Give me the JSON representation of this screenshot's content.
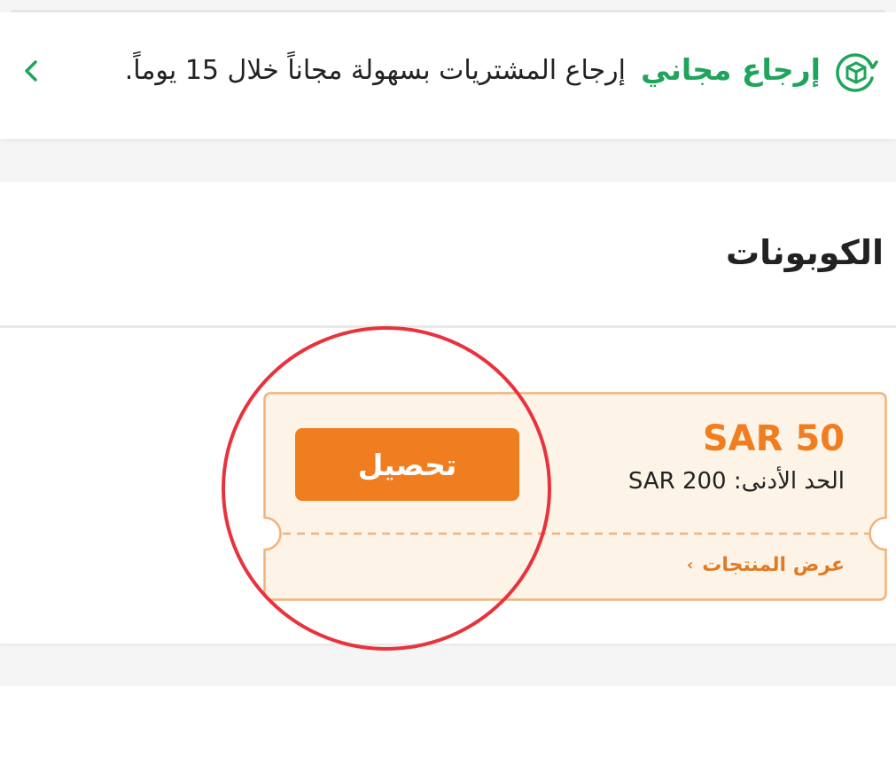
{
  "return_banner": {
    "title": "إرجاع مجاني",
    "description": "إرجاع المشتريات بسهولة مجاناً خلال 15 يوماً.",
    "icon": "return-box-icon",
    "accent": "#1fa55b"
  },
  "coupons": {
    "title": "الكوبونات",
    "coupon": {
      "amount": "SAR 50",
      "minimum": "الحد الأدنى: SAR 200",
      "collect_label": "تحصيل",
      "view_products": "عرض المنتجات",
      "accent": "#f07d1f",
      "background": "#fef3e7"
    }
  },
  "annotation": {
    "color": "#e8333d",
    "shape": "circle"
  }
}
